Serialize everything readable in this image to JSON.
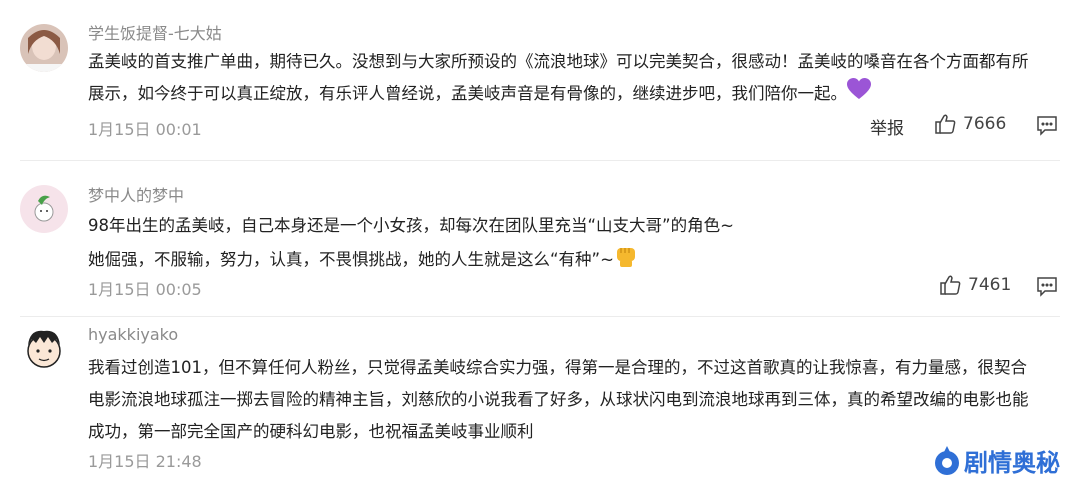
{
  "comments": [
    {
      "username": "学生饭提督-七大姑",
      "lines": [
        "孟美岐的首支推广单曲，期待已久。没想到与大家所预设的《流浪地球》可以完美契合，很感动！孟美岐的嗓音在各个方面都有所",
        "展示，如今终于可以真正绽放，有乐评人曾经说，孟美岐声音是有骨像的，继续进步吧，我们陪你一起。"
      ],
      "emoji": "purple-heart",
      "date": "1月15日 00:01",
      "report_label": "举报",
      "likes": "7666"
    },
    {
      "username": "梦中人的梦中",
      "lines": [
        "98年出生的孟美岐，自己本身还是一个小女孩，却每次在团队里充当“山支大哥”的角色~",
        "她倔强，不服输，努力，认真，不畏惧挑战，她的人生就是这么“有种”~"
      ],
      "emoji": "raised-fist",
      "date": "1月15日 00:05",
      "likes": "7461"
    },
    {
      "username": "hyakkiyako",
      "lines": [
        "我看过创造101，但不算任何人粉丝，只觉得孟美岐综合实力强，得第一是合理的，不过这首歌真的让我惊喜，有力量感，很契合",
        "电影流浪地球孤注一掷去冒险的精神主旨，刘慈欣的小说我看了好多，从球状闪电到流浪地球再到三体，真的希望改编的电影也能",
        "成功，第一部完全国产的硬科幻电影，也祝福孟美岐事业顺利"
      ],
      "date": "1月15日 21:48"
    }
  ],
  "watermark": {
    "text": "剧情奥秘",
    "color": "#2f6fd6"
  },
  "colors": {
    "username": "#8a8a8a",
    "date": "#9a9a9a",
    "text": "#222222"
  }
}
